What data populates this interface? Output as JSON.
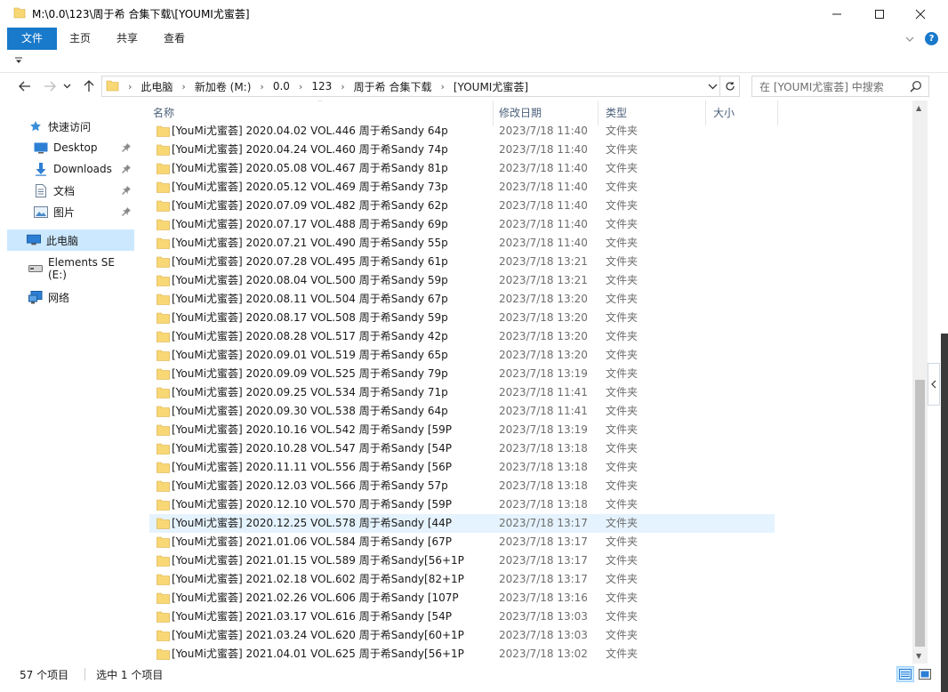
{
  "window": {
    "title": "M:\\0.0\\123\\周于希 合集下载\\[YOUMI尤蜜荟]"
  },
  "ribbon": {
    "tabs": [
      "文件",
      "主页",
      "共享",
      "查看"
    ]
  },
  "address": {
    "crumbs": [
      "此电脑",
      "新加卷 (M:)",
      "0.0",
      "123",
      "周于希 合集下载",
      "[YOUMI尤蜜荟]"
    ]
  },
  "search": {
    "placeholder": "在 [YOUMI尤蜜荟] 中搜索"
  },
  "sidebar": {
    "items": [
      {
        "label": "快速访问",
        "icon": "star-icon"
      },
      {
        "label": "Desktop",
        "icon": "desktop-icon",
        "pinned": true
      },
      {
        "label": "Downloads",
        "icon": "download-icon",
        "pinned": true
      },
      {
        "label": "文档",
        "icon": "document-icon",
        "pinned": true
      },
      {
        "label": "图片",
        "icon": "picture-icon",
        "pinned": true
      },
      {
        "label": "此电脑",
        "icon": "computer-icon",
        "selected": true
      },
      {
        "label": "Elements SE (E:)",
        "icon": "drive-icon"
      },
      {
        "label": "网络",
        "icon": "network-icon"
      }
    ]
  },
  "columns": {
    "name": "名称",
    "date": "修改日期",
    "type": "类型",
    "size": "大小"
  },
  "files": [
    {
      "name": "[YouMi尤蜜荟] 2020.04.02 VOL.446 周于希Sandy 64p",
      "date": "2023/7/18 11:40",
      "type": "文件夹"
    },
    {
      "name": "[YouMi尤蜜荟] 2020.04.24 VOL.460 周于希Sandy 74p",
      "date": "2023/7/18 11:40",
      "type": "文件夹"
    },
    {
      "name": "[YouMi尤蜜荟] 2020.05.08 VOL.467 周于希Sandy 81p",
      "date": "2023/7/18 11:40",
      "type": "文件夹"
    },
    {
      "name": "[YouMi尤蜜荟] 2020.05.12 VOL.469 周于希Sandy 73p",
      "date": "2023/7/18 11:40",
      "type": "文件夹"
    },
    {
      "name": "[YouMi尤蜜荟] 2020.07.09 VOL.482 周于希Sandy 62p",
      "date": "2023/7/18 11:40",
      "type": "文件夹"
    },
    {
      "name": "[YouMi尤蜜荟] 2020.07.17 VOL.488 周于希Sandy 69p",
      "date": "2023/7/18 11:40",
      "type": "文件夹"
    },
    {
      "name": "[YouMi尤蜜荟] 2020.07.21 VOL.490 周于希Sandy 55p",
      "date": "2023/7/18 11:40",
      "type": "文件夹"
    },
    {
      "name": "[YouMi尤蜜荟] 2020.07.28 VOL.495 周于希Sandy 61p",
      "date": "2023/7/18 13:21",
      "type": "文件夹"
    },
    {
      "name": "[YouMi尤蜜荟] 2020.08.04 VOL.500 周于希Sandy 59p",
      "date": "2023/7/18 13:21",
      "type": "文件夹"
    },
    {
      "name": "[YouMi尤蜜荟] 2020.08.11 VOL.504 周于希Sandy 67p",
      "date": "2023/7/18 13:20",
      "type": "文件夹"
    },
    {
      "name": "[YouMi尤蜜荟] 2020.08.17 VOL.508 周于希Sandy 59p",
      "date": "2023/7/18 13:20",
      "type": "文件夹"
    },
    {
      "name": "[YouMi尤蜜荟] 2020.08.28 VOL.517 周于希Sandy 42p",
      "date": "2023/7/18 13:20",
      "type": "文件夹"
    },
    {
      "name": "[YouMi尤蜜荟] 2020.09.01 VOL.519 周于希Sandy 65p",
      "date": "2023/7/18 13:20",
      "type": "文件夹"
    },
    {
      "name": "[YouMi尤蜜荟] 2020.09.09 VOL.525 周于希Sandy 79p",
      "date": "2023/7/18 13:19",
      "type": "文件夹"
    },
    {
      "name": "[YouMi尤蜜荟] 2020.09.25 VOL.534 周于希Sandy 71p",
      "date": "2023/7/18 11:41",
      "type": "文件夹"
    },
    {
      "name": "[YouMi尤蜜荟] 2020.09.30 VOL.538 周于希Sandy 64p",
      "date": "2023/7/18 11:41",
      "type": "文件夹"
    },
    {
      "name": "[YouMi尤蜜荟] 2020.10.16 VOL.542 周于希Sandy [59P",
      "date": "2023/7/18 13:19",
      "type": "文件夹"
    },
    {
      "name": "[YouMi尤蜜荟] 2020.10.28 VOL.547 周于希Sandy [54P",
      "date": "2023/7/18 13:18",
      "type": "文件夹"
    },
    {
      "name": "[YouMi尤蜜荟] 2020.11.11 VOL.556 周于希Sandy [56P",
      "date": "2023/7/18 13:18",
      "type": "文件夹"
    },
    {
      "name": "[YouMi尤蜜荟] 2020.12.03 VOL.566 周于希Sandy 57p",
      "date": "2023/7/18 13:18",
      "type": "文件夹"
    },
    {
      "name": "[YouMi尤蜜荟] 2020.12.10 VOL.570 周于希Sandy [59P",
      "date": "2023/7/18 13:18",
      "type": "文件夹"
    },
    {
      "name": "[YouMi尤蜜荟] 2020.12.25 VOL.578 周于希Sandy [44P",
      "date": "2023/7/18 13:17",
      "type": "文件夹",
      "selected": true
    },
    {
      "name": "[YouMi尤蜜荟] 2021.01.06 VOL.584 周于希Sandy [67P",
      "date": "2023/7/18 13:17",
      "type": "文件夹"
    },
    {
      "name": "[YouMi尤蜜荟] 2021.01.15 VOL.589 周于希Sandy[56+1P",
      "date": "2023/7/18 13:17",
      "type": "文件夹"
    },
    {
      "name": "[YouMi尤蜜荟] 2021.02.18 VOL.602 周于希Sandy[82+1P",
      "date": "2023/7/18 13:17",
      "type": "文件夹"
    },
    {
      "name": "[YouMi尤蜜荟] 2021.02.26 VOL.606 周于希Sandy [107P",
      "date": "2023/7/18 13:16",
      "type": "文件夹"
    },
    {
      "name": "[YouMi尤蜜荟] 2021.03.17 VOL.616 周于希Sandy [54P",
      "date": "2023/7/18 13:03",
      "type": "文件夹"
    },
    {
      "name": "[YouMi尤蜜荟] 2021.03.24 VOL.620 周于希Sandy[60+1P",
      "date": "2023/7/18 13:03",
      "type": "文件夹"
    },
    {
      "name": "[YouMi尤蜜荟] 2021.04.01 VOL.625 周于希Sandy[56+1P",
      "date": "2023/7/18 13:02",
      "type": "文件夹"
    }
  ],
  "status": {
    "count": "57 个项目",
    "selection": "选中 1 个项目"
  },
  "colors": {
    "accent": "#1979ca",
    "selected_row": "#e5f3ff",
    "selected_nav": "#cce8ff",
    "folder": "#f8d775"
  }
}
